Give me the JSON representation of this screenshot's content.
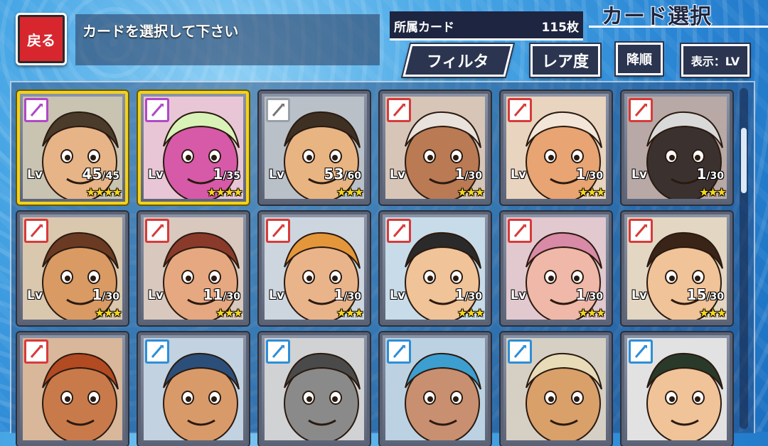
{
  "header": {
    "back_label": "戻る",
    "prompt": "カードを選択して下さい",
    "owned_label": "所属カード",
    "owned_count": "115枚",
    "title": "カード選択"
  },
  "toolbar": {
    "filter_label": "フィルタ",
    "rarity_label": "レア度",
    "order_label": "降順",
    "view_label": "表示：LV"
  },
  "cards": [
    {
      "lv_label": "Lv",
      "level": "45",
      "max": "/45",
      "stars": "★★★★",
      "frame": "gold",
      "weapon": "purple",
      "bg": "#c9c3b2",
      "skin": "#e7b487",
      "hair": "#4a3b2b"
    },
    {
      "lv_label": "Lv",
      "level": "1",
      "max": "/35",
      "stars": "★★★★",
      "frame": "gold",
      "weapon": "purple",
      "bg": "#e8c6d6",
      "skin": "#d65aa8",
      "hair": "#d9f2b8"
    },
    {
      "lv_label": "Lv",
      "level": "53",
      "max": "/60",
      "stars": "★★★",
      "frame": "",
      "weapon": "gray",
      "bg": "#b9c0c8",
      "skin": "#e8b482",
      "hair": "#3e3124"
    },
    {
      "lv_label": "Lv",
      "level": "1",
      "max": "/30",
      "stars": "★★★",
      "frame": "",
      "weapon": "red",
      "bg": "#d7c6b8",
      "skin": "#b97a54",
      "hair": "#e9e2dc"
    },
    {
      "lv_label": "Lv",
      "level": "1",
      "max": "/30",
      "stars": "★★★",
      "frame": "",
      "weapon": "red",
      "bg": "#e9d4bf",
      "skin": "#e8a472",
      "hair": "#f3e6d8"
    },
    {
      "lv_label": "Lv",
      "level": "1",
      "max": "/30",
      "stars": "★★★",
      "frame": "",
      "weapon": "red",
      "bg": "#b8a9a6",
      "skin": "#3b3230",
      "hair": "#d9d9d9"
    },
    {
      "lv_label": "Lv",
      "level": "1",
      "max": "/30",
      "stars": "★★★",
      "frame": "",
      "weapon": "red",
      "bg": "#d9c7ae",
      "skin": "#d99a64",
      "hair": "#6a3b22"
    },
    {
      "lv_label": "Lv",
      "level": "11",
      "max": "/30",
      "stars": "★★★",
      "frame": "",
      "weapon": "red",
      "bg": "#d8c8be",
      "skin": "#e6a880",
      "hair": "#8a3a2a"
    },
    {
      "lv_label": "Lv",
      "level": "1",
      "max": "/30",
      "stars": "★★★",
      "frame": "",
      "weapon": "red",
      "bg": "#cdd6df",
      "skin": "#eab48a",
      "hair": "#e4963a"
    },
    {
      "lv_label": "Lv",
      "level": "1",
      "max": "/30",
      "stars": "★★★",
      "frame": "",
      "weapon": "red",
      "bg": "#c8dbe8",
      "skin": "#f0c398",
      "hair": "#2a2a2a"
    },
    {
      "lv_label": "Lv",
      "level": "1",
      "max": "/30",
      "stars": "★★★",
      "frame": "",
      "weapon": "red",
      "bg": "#e2c8cf",
      "skin": "#f0b8a8",
      "hair": "#d88aa6"
    },
    {
      "lv_label": "Lv",
      "level": "15",
      "max": "/30",
      "stars": "★★★",
      "frame": "",
      "weapon": "red",
      "bg": "#e3d6c3",
      "skin": "#f0c398",
      "hair": "#3a2418"
    },
    {
      "lv_label": "",
      "level": "",
      "max": "",
      "stars": "",
      "frame": "",
      "weapon": "red",
      "bg": "#d8b79a",
      "skin": "#c97a4a",
      "hair": "#b24a22"
    },
    {
      "lv_label": "",
      "level": "",
      "max": "",
      "stars": "",
      "frame": "",
      "weapon": "blue",
      "bg": "#c2d2e0",
      "skin": "#d99a6a",
      "hair": "#2c4f7a"
    },
    {
      "lv_label": "",
      "level": "",
      "max": "",
      "stars": "",
      "frame": "",
      "weapon": "blue",
      "bg": "#d0d2d4",
      "skin": "#8a8a8a",
      "hair": "#4a4a4a"
    },
    {
      "lv_label": "",
      "level": "",
      "max": "",
      "stars": "",
      "frame": "",
      "weapon": "blue",
      "bg": "#bcd2e2",
      "skin": "#c89070",
      "hair": "#3d9ed0"
    },
    {
      "lv_label": "",
      "level": "",
      "max": "",
      "stars": "",
      "frame": "",
      "weapon": "blue",
      "bg": "#d6d0c4",
      "skin": "#d9a06a",
      "hair": "#e8dcb8"
    },
    {
      "lv_label": "",
      "level": "",
      "max": "",
      "stars": "",
      "frame": "",
      "weapon": "blue",
      "bg": "#e2e2e2",
      "skin": "#f0c398",
      "hair": "#2a3a2a"
    }
  ]
}
